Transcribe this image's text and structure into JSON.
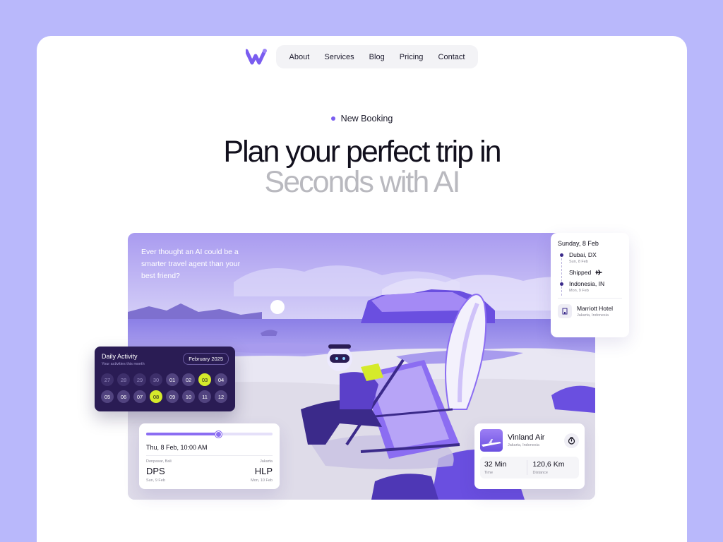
{
  "nav": {
    "items": [
      "About",
      "Services",
      "Blog",
      "Pricing",
      "Contact"
    ]
  },
  "hero": {
    "tag": "New Booking",
    "title_line1": "Plan your perfect trip in",
    "title_line2": "Seconds with AI"
  },
  "scene": {
    "quote": "Ever thought an AI could be a smarter travel agent than your best friend?"
  },
  "itinerary": {
    "date": "Sunday, 8 Feb",
    "from": {
      "city": "Dubai, DX",
      "date": "Sun, 8 Feb"
    },
    "status": "Shipped",
    "to": {
      "city": "Indonesia, IN",
      "date": "Mon, 9 Feb"
    },
    "hotel": {
      "name": "Marriott Hotel",
      "location": "Jakarta, Indonesia"
    }
  },
  "daily_activity": {
    "title": "Daily Activity",
    "subtitle": "Your activities this month",
    "month": "February 2025",
    "days": [
      {
        "label": "27",
        "state": "past"
      },
      {
        "label": "28",
        "state": "past"
      },
      {
        "label": "29",
        "state": "past"
      },
      {
        "label": "30",
        "state": "past"
      },
      {
        "label": "01",
        "state": "normal"
      },
      {
        "label": "02",
        "state": "normal"
      },
      {
        "label": "03",
        "state": "highlight"
      },
      {
        "label": "04",
        "state": "normal"
      },
      {
        "label": "05",
        "state": "normal"
      },
      {
        "label": "06",
        "state": "normal"
      },
      {
        "label": "07",
        "state": "normal"
      },
      {
        "label": "08",
        "state": "highlight"
      },
      {
        "label": "09",
        "state": "normal"
      },
      {
        "label": "10",
        "state": "normal"
      },
      {
        "label": "11",
        "state": "normal"
      },
      {
        "label": "12",
        "state": "normal"
      }
    ]
  },
  "flight": {
    "progress": 0.57,
    "when": "Thu, 8 Feb, 10:00 AM",
    "from": {
      "city": "Denpasar, Bali",
      "code": "DPS",
      "date": "Sun, 9 Feb"
    },
    "to": {
      "city": "Jakarta",
      "code": "HLP",
      "date": "Mon, 10 Feb"
    }
  },
  "airline": {
    "name": "Vinland Air",
    "location": "Jakarta, Indonesia",
    "time_value": "32 Min",
    "time_label": "Time",
    "distance_value": "120,6 Km",
    "distance_label": "Distance"
  },
  "colors": {
    "page_bg": "#b9b8fb",
    "accent": "#7a5df0",
    "dark": "#2a1c54",
    "highlight": "#d5ea2b",
    "muted_title": "#b9b9bf"
  }
}
